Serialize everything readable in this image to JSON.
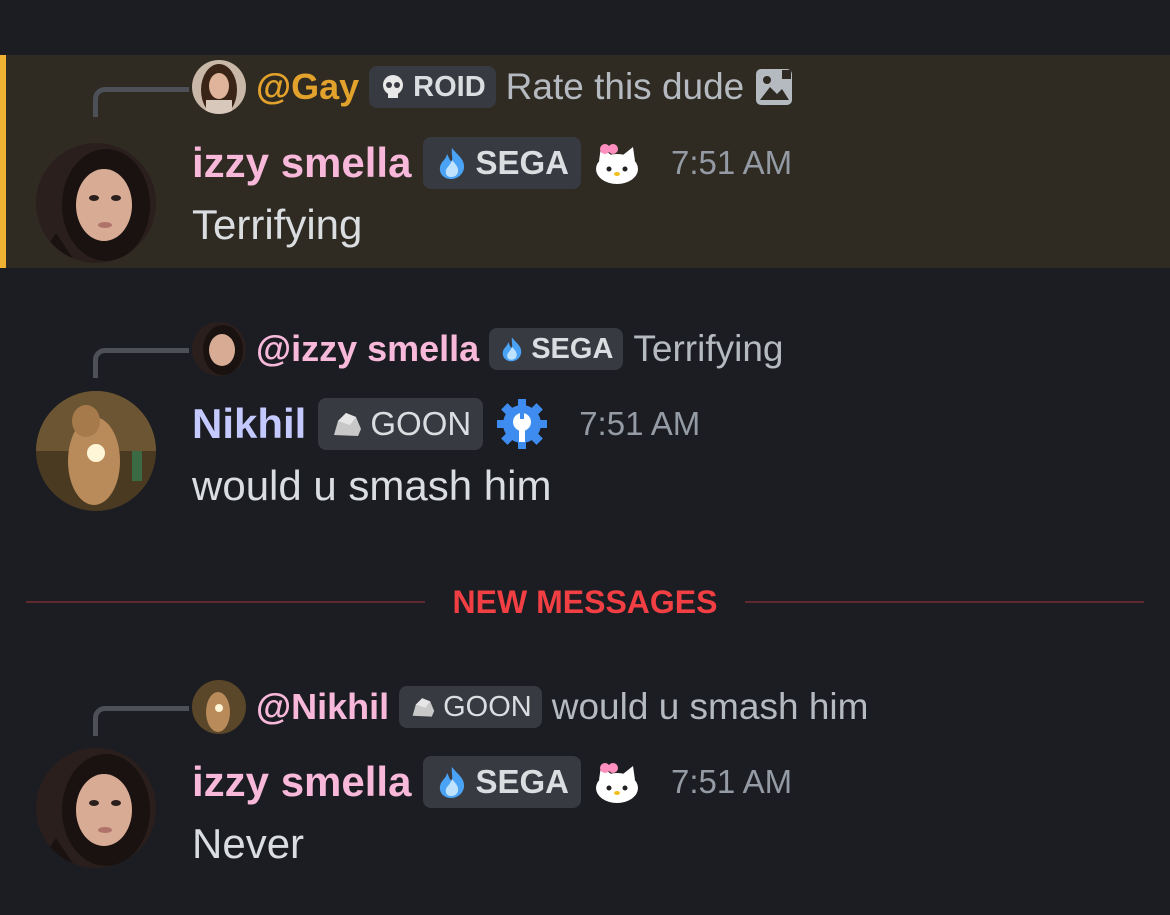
{
  "messages": [
    {
      "reply": {
        "name": "@Gay",
        "tag": "ROID",
        "text": "Rate this dude"
      },
      "author": "izzy smella",
      "tag": "SEGA",
      "timestamp": "7:51 AM",
      "content": "Terrifying"
    },
    {
      "reply": {
        "name": "@izzy smella",
        "tag": "SEGA",
        "text": "Terrifying"
      },
      "author": "Nikhil",
      "tag": "GOON",
      "timestamp": "7:51 AM",
      "content": "would u smash him"
    },
    {
      "reply": {
        "name": "@Nikhil",
        "tag": "GOON",
        "text": "would u smash him"
      },
      "author": "izzy smella",
      "tag": "SEGA",
      "timestamp": "7:51 AM",
      "content": "Never"
    }
  ],
  "divider": {
    "label": "NEW MESSAGES"
  },
  "colors": {
    "highlight_bg": "#2f2b23",
    "highlight_bar": "#f0b232",
    "gay_name": "#e2a22b",
    "izzy_name": "#f7b8d9",
    "nikhil_name": "#c4c9ff",
    "new_messages": "#f23f43"
  },
  "icons": {
    "roid_tag": "skull-icon",
    "sega_tag": "blue-flame-icon",
    "goon_tag": "rock-icon",
    "attachment": "image-icon",
    "izzy_decoration": "hello-kitty-icon",
    "nikhil_decoration": "gear-bot-icon"
  }
}
